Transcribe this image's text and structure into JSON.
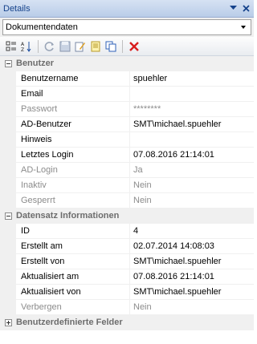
{
  "window": {
    "title": "Details"
  },
  "combo": {
    "value": "Dokumentendaten"
  },
  "toolbar": {
    "icons": [
      "categorized-icon",
      "alphabetical-sort-icon",
      "refresh-icon",
      "save-icon",
      "edit-icon",
      "page-icon",
      "copy-icon",
      "delete-icon"
    ]
  },
  "categories": [
    {
      "label": "Benutzer",
      "expanded": true,
      "rows": [
        {
          "name": "Benutzername",
          "value": "spuehler",
          "disabled": false
        },
        {
          "name": "Email",
          "value": "",
          "disabled": false
        },
        {
          "name": "Passwort",
          "value": "********",
          "disabled": true
        },
        {
          "name": "AD-Benutzer",
          "value": "SMT\\michael.spuehler",
          "disabled": false
        },
        {
          "name": "Hinweis",
          "value": "",
          "disabled": false
        },
        {
          "name": "Letztes Login",
          "value": "07.08.2016 21:14:01",
          "disabled": false
        },
        {
          "name": "AD-Login",
          "value": "Ja",
          "disabled": true
        },
        {
          "name": "Inaktiv",
          "value": "Nein",
          "disabled": true
        },
        {
          "name": "Gesperrt",
          "value": "Nein",
          "disabled": true
        }
      ]
    },
    {
      "label": "Datensatz Informationen",
      "expanded": true,
      "rows": [
        {
          "name": "ID",
          "value": "4",
          "disabled": false
        },
        {
          "name": "Erstellt am",
          "value": "02.07.2014 14:08:03",
          "disabled": false
        },
        {
          "name": "Erstellt von",
          "value": "SMT\\michael.spuehler",
          "disabled": false
        },
        {
          "name": "Aktualisiert am",
          "value": "07.08.2016 21:14:01",
          "disabled": false
        },
        {
          "name": "Aktualisiert von",
          "value": "SMT\\michael.spuehler",
          "disabled": false
        },
        {
          "name": "Verbergen",
          "value": "Nein",
          "disabled": true
        }
      ]
    },
    {
      "label": "Benutzerdefinierte Felder",
      "expanded": false,
      "rows": []
    }
  ],
  "colors": {
    "header_text": "#15428b",
    "disabled_text": "#8c8c8c",
    "category_bg": "#f0f0f0",
    "delete_red": "#d81e1e"
  }
}
